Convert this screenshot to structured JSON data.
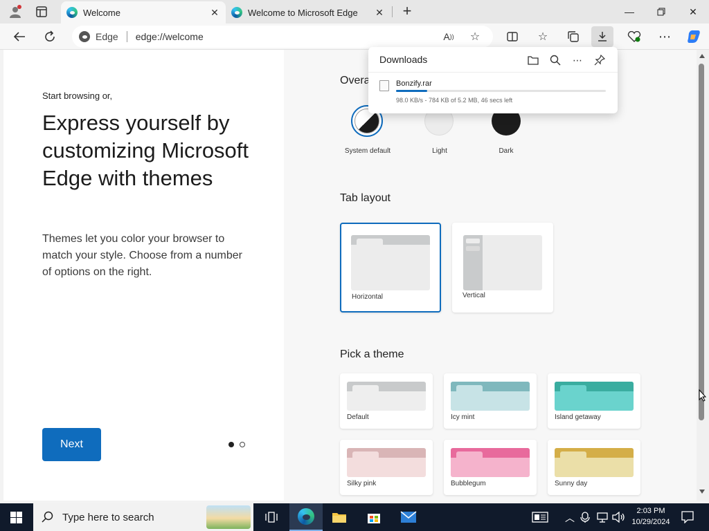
{
  "browser": {
    "tabs": [
      {
        "title": "Welcome"
      },
      {
        "title": "Welcome to Microsoft Edge"
      }
    ],
    "address": {
      "site_label": "Edge",
      "url": "edge://welcome"
    }
  },
  "downloads": {
    "title": "Downloads",
    "file_name": "Bonzify.rar",
    "status": "98.0 KB/s - 784 KB of 5.2 MB, 46 secs left",
    "progress": 0.15
  },
  "left": {
    "kicker": "Start browsing or,",
    "headline": "Express yourself by customizing Microsoft Edge with themes",
    "description": "Themes let you color your browser to match your style. Choose from a number of options on the right.",
    "next_label": "Next"
  },
  "overall": {
    "title": "Overa",
    "modes": [
      {
        "label": "System default"
      },
      {
        "label": "Light"
      },
      {
        "label": "Dark"
      }
    ]
  },
  "tab_layout": {
    "title": "Tab layout",
    "options": [
      {
        "label": "Horizontal"
      },
      {
        "label": "Vertical"
      }
    ]
  },
  "themes": {
    "title": "Pick a theme",
    "items": [
      {
        "label": "Default",
        "top": "#c8cacb",
        "bottom": "#eeeeee"
      },
      {
        "label": "Icy mint",
        "top": "#7fb8bd",
        "bottom": "#c7e3e6"
      },
      {
        "label": "Island getaway",
        "top": "#3aada0",
        "bottom": "#6ad3cd"
      },
      {
        "label": "Silky pink",
        "top": "#d9b5b6",
        "bottom": "#f3dddd"
      },
      {
        "label": "Bubblegum",
        "top": "#e86a9c",
        "bottom": "#f5b3cc"
      },
      {
        "label": "Sunny day",
        "top": "#d4ae48",
        "bottom": "#ebdfa8"
      }
    ]
  },
  "taskbar": {
    "search_placeholder": "Type here to search",
    "time": "2:03 PM",
    "date": "10/29/2024"
  },
  "colors": {
    "accent": "#0f6cbd",
    "taskbar": "#101a2b"
  }
}
